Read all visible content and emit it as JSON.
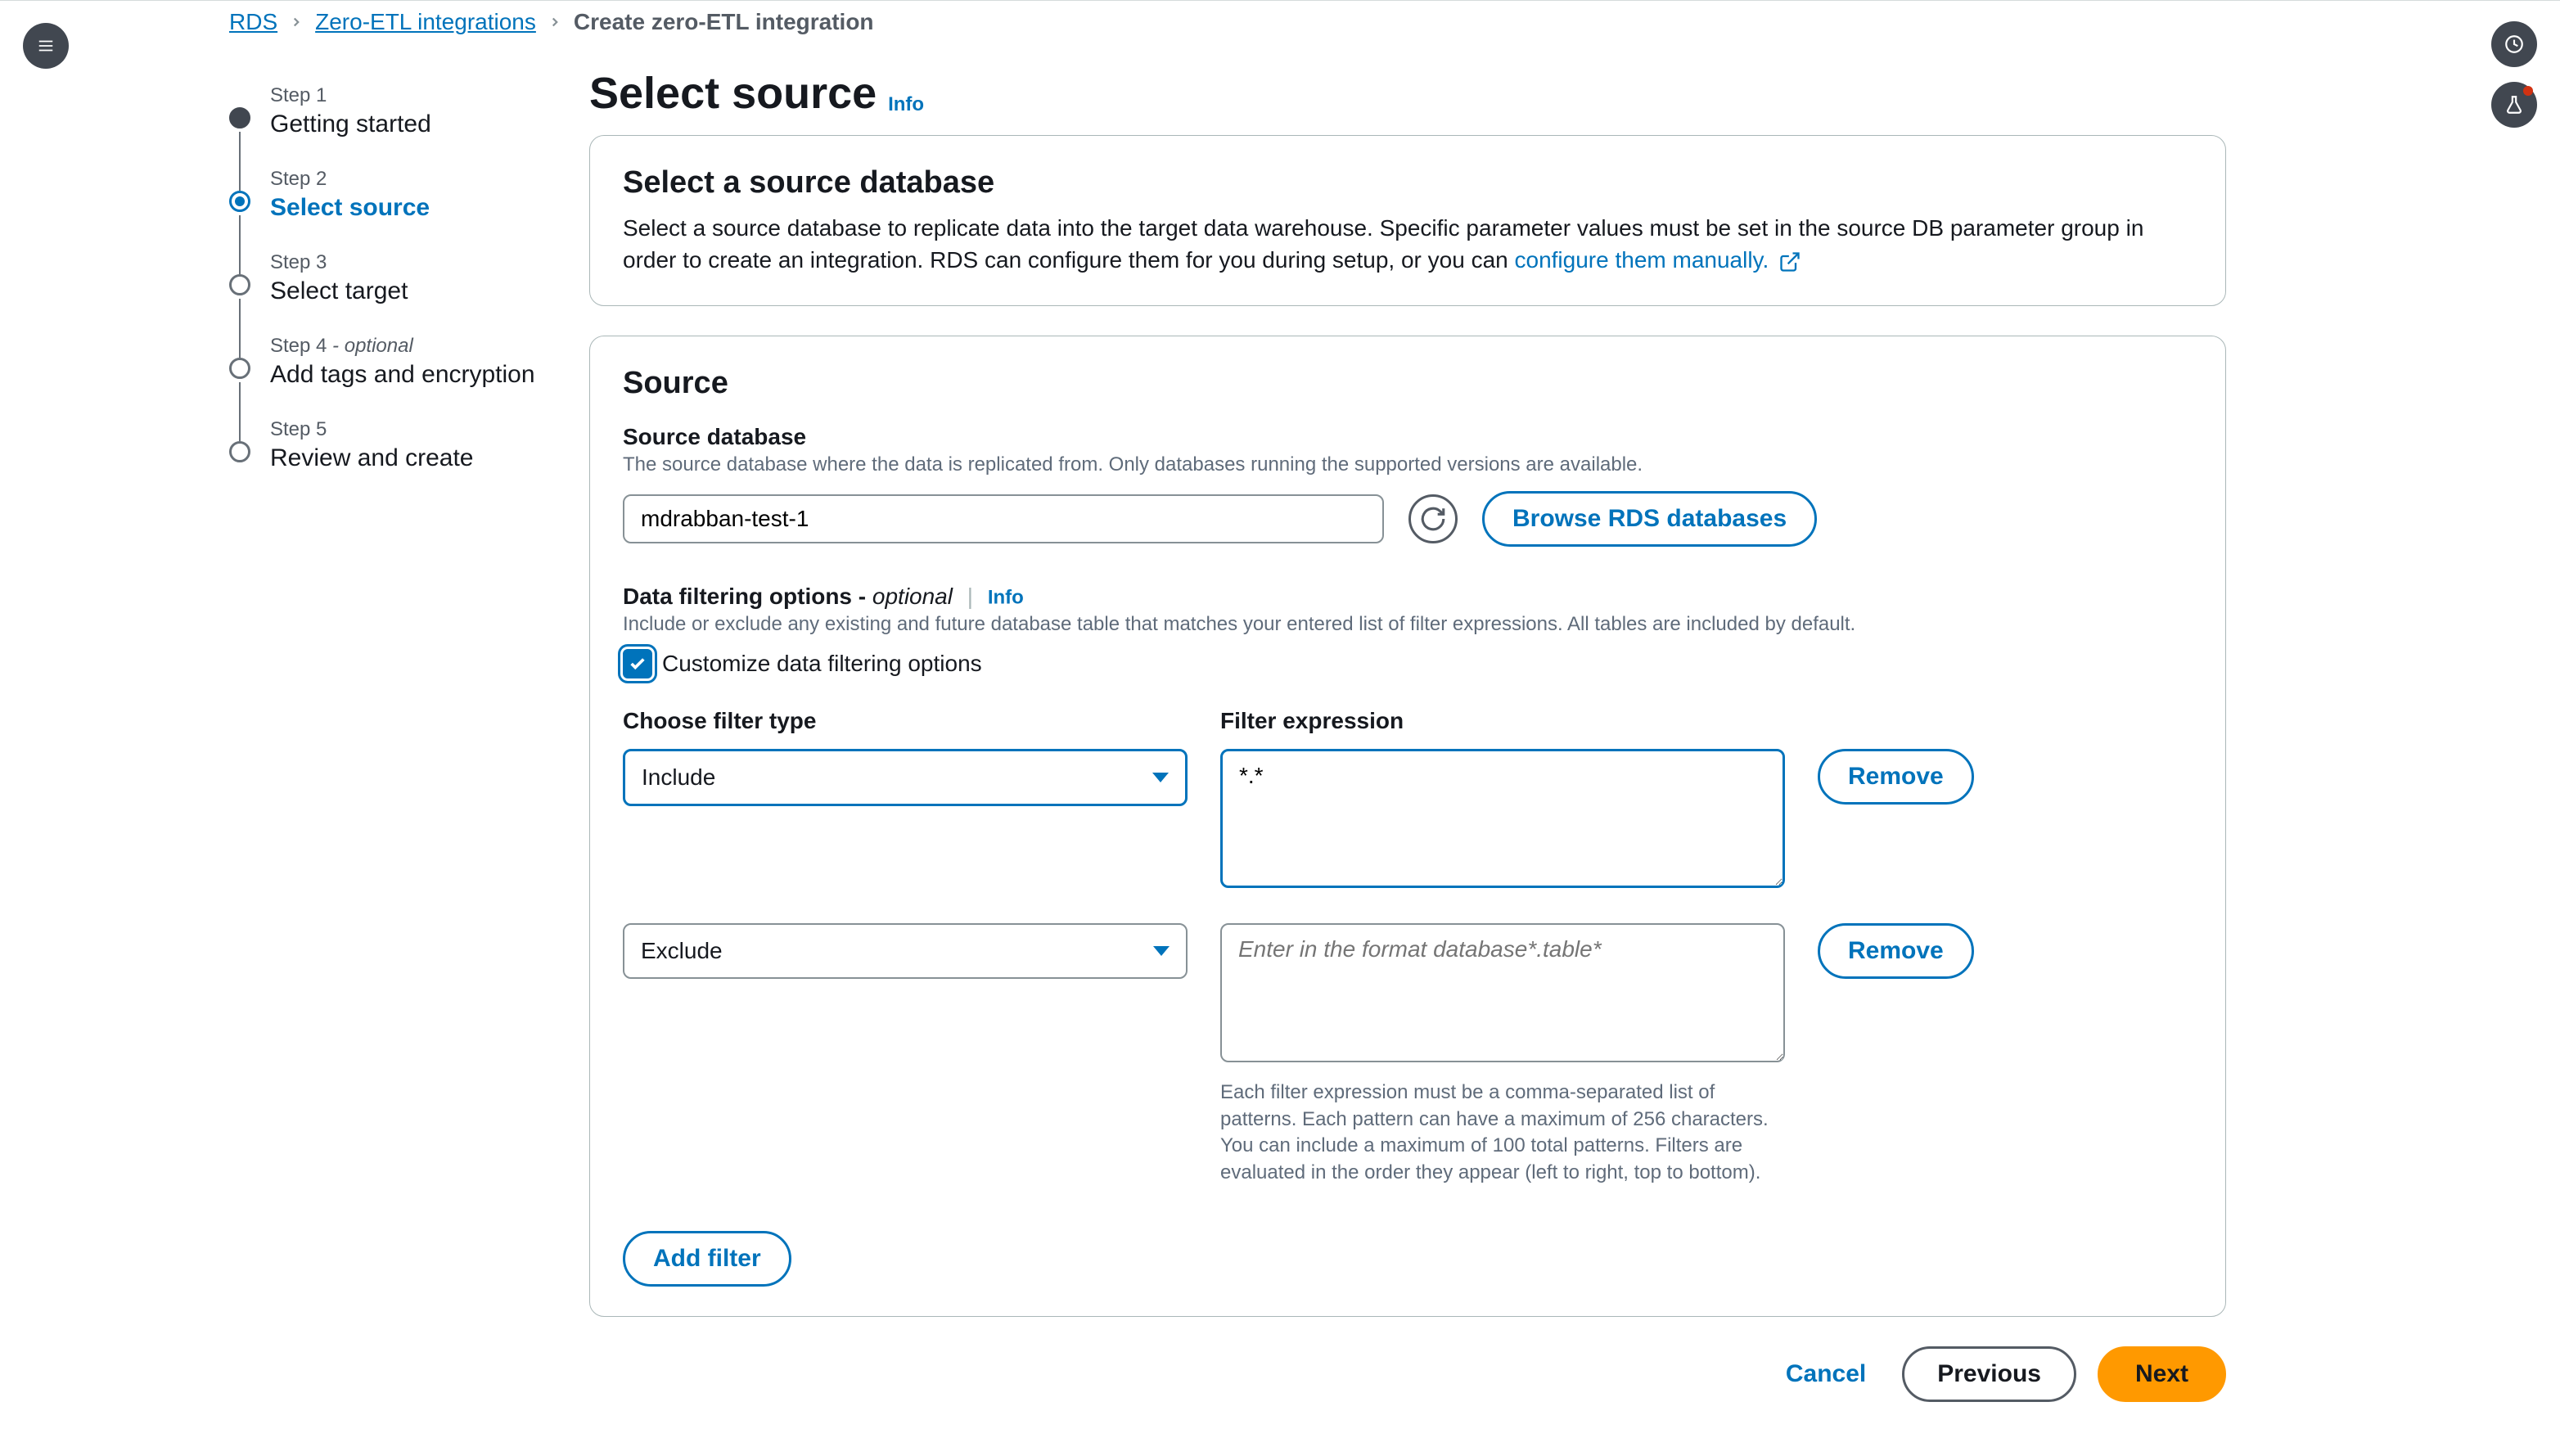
{
  "breadcrumb": {
    "items": [
      "RDS",
      "Zero-ETL integrations",
      "Create zero-ETL integration"
    ]
  },
  "steps": [
    {
      "num": "Step 1",
      "label": "Getting started",
      "state": "completed"
    },
    {
      "num": "Step 2",
      "label": "Select source",
      "state": "current"
    },
    {
      "num": "Step 3",
      "label": "Select target",
      "state": "upcoming"
    },
    {
      "num": "Step 4",
      "optional": " - optional",
      "label": "Add tags and encryption",
      "state": "upcoming"
    },
    {
      "num": "Step 5",
      "label": "Review and create",
      "state": "upcoming"
    }
  ],
  "page": {
    "title": "Select source",
    "info": "Info"
  },
  "panel1": {
    "title": "Select a source database",
    "desc_pre": "Select a source database to replicate data into the target data warehouse. Specific parameter values must be set in the source DB parameter group in order to create an integration. RDS can configure them for you during setup, or you can ",
    "config_link": "configure them manually."
  },
  "source": {
    "title": "Source",
    "db_label": "Source database",
    "db_help": "The source database where the data is replicated from. Only databases running the supported versions are available.",
    "db_value": "mdrabban-test-1",
    "browse_btn": "Browse RDS databases",
    "filter_head": "Data filtering options - ",
    "filter_head_opt": "optional",
    "filter_info": "Info",
    "filter_help": "Include or exclude any existing and future database table that matches your entered list of filter expressions. All tables are included by default.",
    "customize_label": "Customize data filtering options",
    "col1": "Choose filter type",
    "col2": "Filter expression",
    "filters": [
      {
        "type": "Include",
        "expr": "*.*",
        "remove": "Remove"
      },
      {
        "type": "Exclude",
        "expr": "",
        "placeholder": "Enter in the format database*.table*",
        "remove": "Remove"
      }
    ],
    "expr_help": "Each filter expression must be a comma-separated list of patterns. Each pattern can have a maximum of 256 characters. You can include a maximum of 100 total patterns. Filters are evaluated in the order they appear (left to right, top to bottom).",
    "add_filter": "Add filter"
  },
  "footer": {
    "cancel": "Cancel",
    "previous": "Previous",
    "next": "Next"
  }
}
